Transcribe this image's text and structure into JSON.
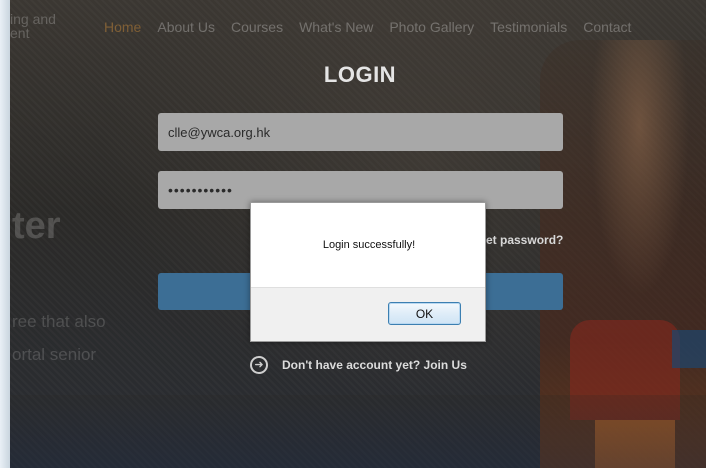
{
  "nav": {
    "brand": "ing and\nent",
    "items": [
      "Home",
      "About Us",
      "Courses",
      "What's New",
      "Photo Gallery",
      "Testimonials",
      "Contact"
    ]
  },
  "hero": {
    "title": "ter",
    "line1": "ree that also",
    "line2": "ortal senior"
  },
  "login": {
    "title": "LOGIN",
    "email_value": "clle@ywca.org.hk",
    "password_value": "•••••••••••",
    "forgot_label": "et password?",
    "join_icon": "arrow-right-circle-icon",
    "join_label": "Don't have account yet? Join Us"
  },
  "dialog": {
    "message": "Login successfully!",
    "ok_label": "OK"
  },
  "colors": {
    "login_button": "#3c6e95",
    "field_bg": "#a8a8a8",
    "active_nav": "#ffaa3c"
  }
}
